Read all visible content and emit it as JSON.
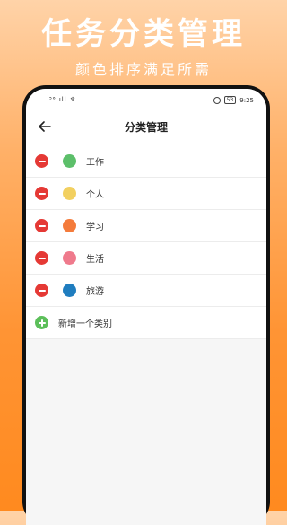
{
  "promo": {
    "title": "任务分类管理",
    "subtitle": "颜色排序满足所需"
  },
  "status_bar": {
    "left": "⁵⁶.ıll ♆",
    "battery": "53",
    "time": "9:25"
  },
  "app_bar": {
    "back_icon": "arrow-left-icon",
    "title": "分类管理"
  },
  "categories": [
    {
      "label": "工作",
      "color": "#5cbf6a"
    },
    {
      "label": "个人",
      "color": "#f2d060"
    },
    {
      "label": "学习",
      "color": "#f47b3b"
    },
    {
      "label": "生活",
      "color": "#ef7a8c"
    },
    {
      "label": "旅游",
      "color": "#1f7dbf"
    }
  ],
  "add_category": {
    "label": "新增一个类别"
  },
  "colors": {
    "remove": "#e53935",
    "add": "#5cbf5a"
  }
}
